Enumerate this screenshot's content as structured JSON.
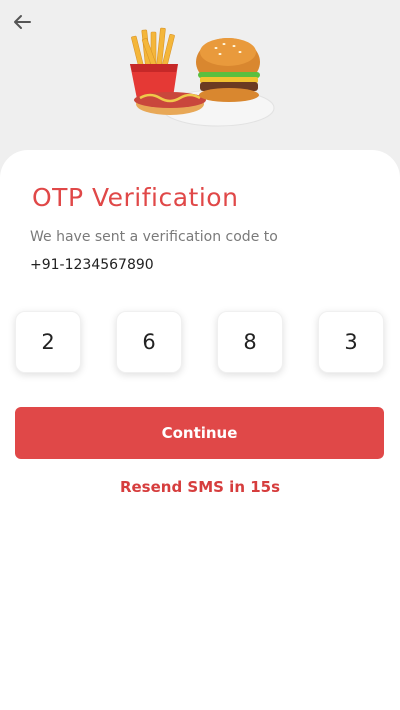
{
  "screen": {
    "title": "OTP Verification",
    "subtitle": "We have sent a verification code to",
    "phone": "+91-1234567890"
  },
  "otp": {
    "digits": [
      "2",
      "6",
      "8",
      "3"
    ]
  },
  "actions": {
    "continue_label": "Continue",
    "resend_label": "Resend SMS in 15s"
  },
  "colors": {
    "accent": "#e04848",
    "background": "#efefef"
  },
  "icons": {
    "back": "arrow-left-icon",
    "hero": "fast-food-illustration"
  }
}
